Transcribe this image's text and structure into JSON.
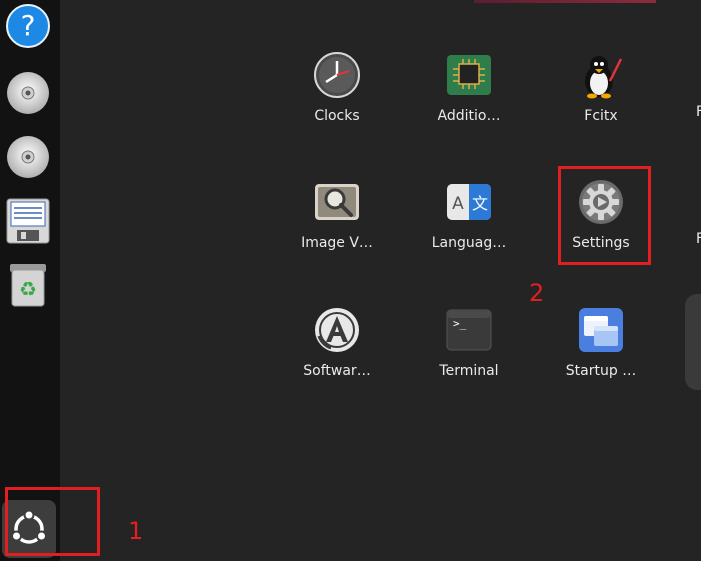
{
  "dock": {
    "items": [
      {
        "name": "help-icon",
        "glyph": "?"
      },
      {
        "name": "disc-icon-1"
      },
      {
        "name": "disc-icon-2"
      },
      {
        "name": "save-icon"
      },
      {
        "name": "trash-icon",
        "glyph": "♻"
      }
    ],
    "show_apps_name": "ubuntu-logo-icon"
  },
  "apps": [
    {
      "label": "Clocks",
      "icon": "clock-icon"
    },
    {
      "label": "Additio…",
      "icon": "chip-icon"
    },
    {
      "label": "Fcitx",
      "icon": "penguin-icon"
    },
    {
      "label": "Image V…",
      "icon": "image-viewer-icon"
    },
    {
      "label": "Languag…",
      "icon": "language-icon",
      "glyph_left": "A",
      "glyph_right": "文"
    },
    {
      "label": "Settings",
      "icon": "gear-icon"
    },
    {
      "label": "Softwar…",
      "icon": "software-icon"
    },
    {
      "label": "Terminal",
      "icon": "terminal-icon",
      "glyph": ">_"
    },
    {
      "label": "Startup …",
      "icon": "window-icon"
    }
  ],
  "edge_labels": [
    "F",
    "F"
  ],
  "annotations": {
    "one": "1",
    "two": "2",
    "color": "#e02020"
  },
  "colors": {
    "background": "#242424",
    "dock": "#121212",
    "accent_blue": "#1e88e5"
  }
}
